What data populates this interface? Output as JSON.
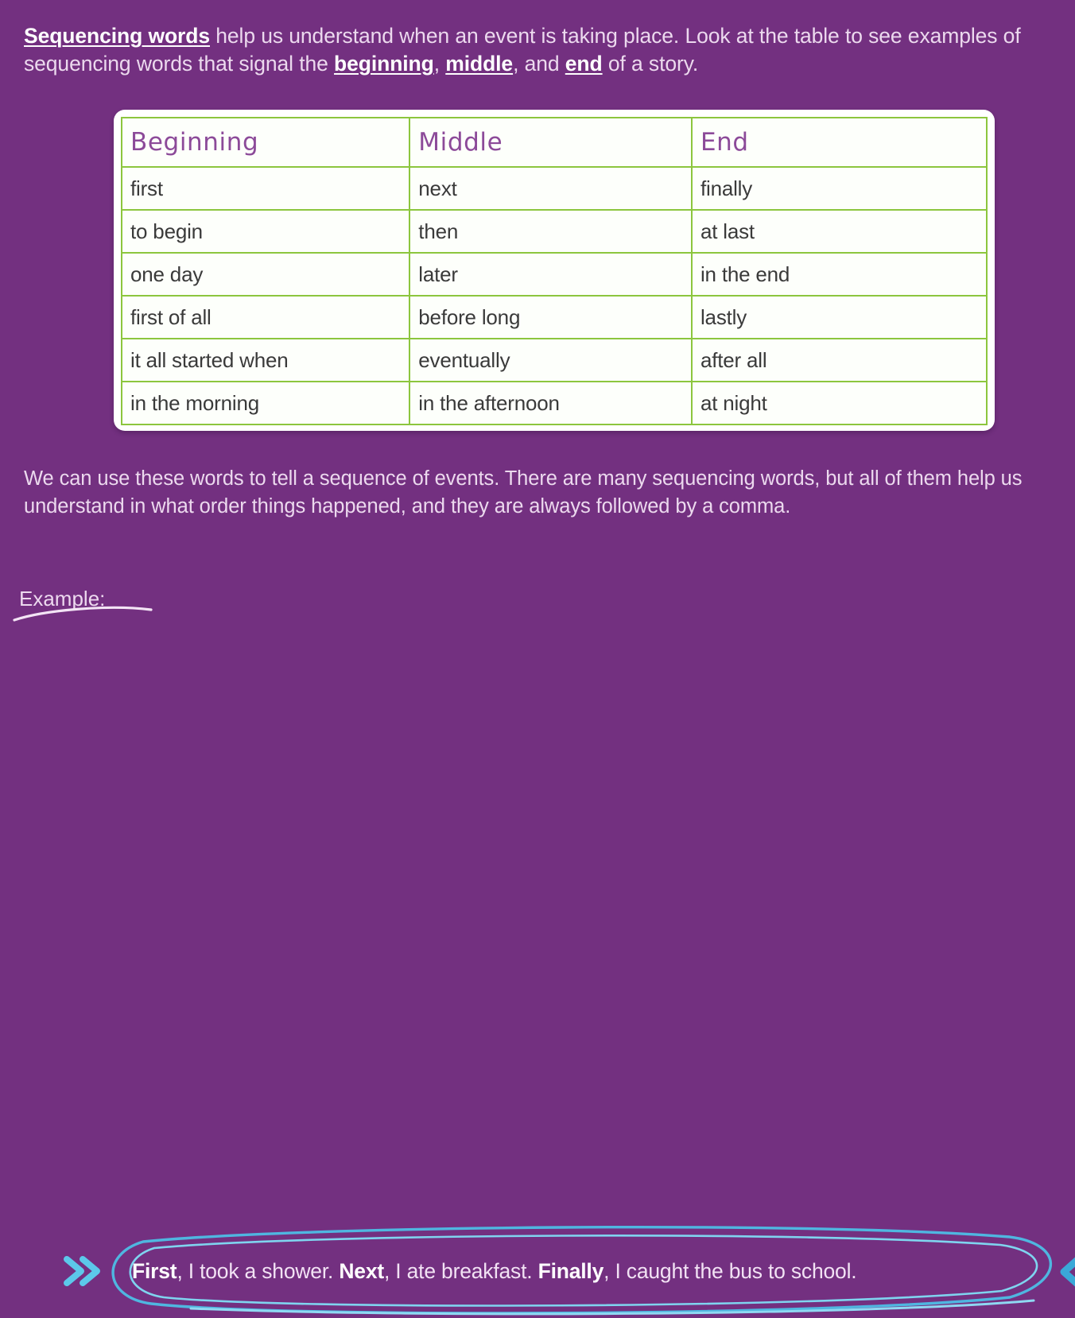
{
  "colors": {
    "background": "#733080",
    "table_border_green": "#8cc63e",
    "header_purple": "#8c4a99",
    "body_text": "#ecd9ee",
    "annotation_blue": "#4fc3e8"
  },
  "intro": {
    "lead": "Sequencing words",
    "part1": " help us understand when an event is taking place. Look at the table to see examples of sequencing words that signal the ",
    "b1": "beginning",
    "sep1": ", ",
    "b2": "middle",
    "sep2": ", and ",
    "b3": "end",
    "tail": " of a story."
  },
  "table": {
    "headers": [
      "Beginning",
      "Middle",
      "End"
    ],
    "rows": [
      [
        "first",
        "next",
        "finally"
      ],
      [
        "to begin",
        "then",
        "at last"
      ],
      [
        "one day",
        "later",
        "in the end"
      ],
      [
        "first of all",
        "before long",
        "lastly"
      ],
      [
        "it all started when",
        "eventually",
        "after all"
      ],
      [
        "in the morning",
        "in the afternoon",
        "at night"
      ]
    ]
  },
  "paragraph2": "We can use these words to tell a sequence of events. There are many sequencing words, but all of them help us understand in what order things happened, and they are always followed by a comma.",
  "example": {
    "label": "Example:",
    "w1": "First",
    "t1": ", I took a shower. ",
    "w2": "Next",
    "t2": ", I ate breakfast. ",
    "w3": "Finally",
    "t3": ", I caught the bus to school."
  }
}
